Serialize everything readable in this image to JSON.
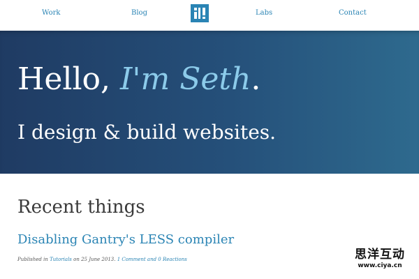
{
  "nav": {
    "items": [
      {
        "label": "Work"
      },
      {
        "label": "Blog"
      },
      {
        "label": "Labs"
      },
      {
        "label": "Contact"
      }
    ],
    "logo": {
      "icon": "site-logo-icon",
      "color": "#2a84b4"
    }
  },
  "hero": {
    "hello_prefix": "Hello,",
    "hello_name": "I'm Seth",
    "hello_suffix": ".",
    "tagline": "I design & build websites.",
    "accent_color": "#8ccbea"
  },
  "recent": {
    "heading": "Recent things",
    "post": {
      "title": "Disabling Gantry's LESS compiler",
      "meta_published": "Published in",
      "category": "Tutorials",
      "meta_on": "on 25 June 2013.",
      "comments": "1 Comment and 0 Reactions"
    }
  },
  "watermark": {
    "line1": "思洋互动",
    "line2": "www.ciya.cn"
  }
}
